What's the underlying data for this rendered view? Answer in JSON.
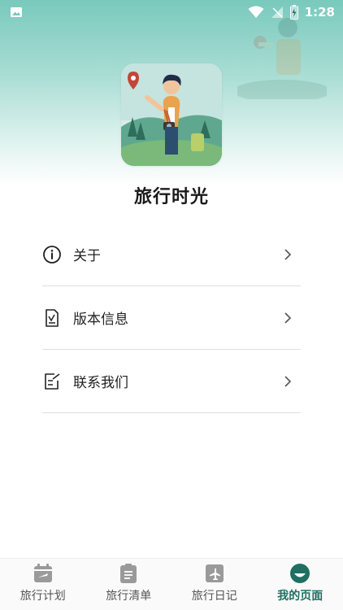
{
  "status_bar": {
    "time": "1:28",
    "icons": [
      "image-icon",
      "wifi-icon",
      "signal-icon",
      "battery-icon"
    ]
  },
  "app": {
    "name": "旅行时光",
    "logo_icon": "traveler-logo-icon"
  },
  "menu": {
    "items": [
      {
        "label": "关于",
        "icon": "info-icon"
      },
      {
        "label": "版本信息",
        "icon": "document-check-icon"
      },
      {
        "label": "联系我们",
        "icon": "edit-note-icon"
      }
    ]
  },
  "tabbar": {
    "tabs": [
      {
        "label": "旅行计划",
        "icon": "calendar-plane-icon",
        "active": false
      },
      {
        "label": "旅行清单",
        "icon": "clipboard-list-icon",
        "active": false
      },
      {
        "label": "旅行日记",
        "icon": "diary-plane-icon",
        "active": false
      },
      {
        "label": "我的页面",
        "icon": "profile-icon",
        "active": true
      }
    ]
  },
  "colors": {
    "accent": "#1f6f63",
    "hero_top": "#79c9bd",
    "divider": "#dedede"
  }
}
